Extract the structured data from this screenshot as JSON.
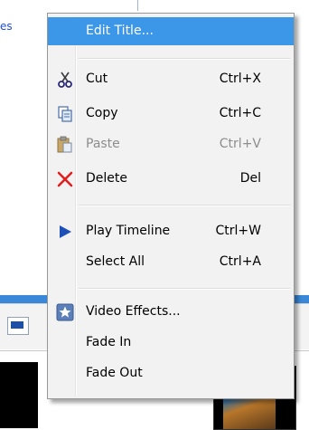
{
  "background": {
    "partial_text": "es"
  },
  "menu": {
    "items": [
      {
        "label": "Edit Title...",
        "shortcut": "",
        "icon": "",
        "state": "highlighted"
      },
      {
        "label": "Cut",
        "shortcut": "Ctrl+X",
        "icon": "scissors-icon",
        "state": "enabled"
      },
      {
        "label": "Copy",
        "shortcut": "Ctrl+C",
        "icon": "copy-icon",
        "state": "enabled"
      },
      {
        "label": "Paste",
        "shortcut": "Ctrl+V",
        "icon": "paste-icon",
        "state": "disabled"
      },
      {
        "label": "Delete",
        "shortcut": "Del",
        "icon": "delete-x-icon",
        "state": "enabled"
      },
      {
        "label": "Play Timeline",
        "shortcut": "Ctrl+W",
        "icon": "play-icon",
        "state": "enabled"
      },
      {
        "label": "Select All",
        "shortcut": "Ctrl+A",
        "icon": "",
        "state": "enabled"
      },
      {
        "label": "Video Effects...",
        "shortcut": "",
        "icon": "star-icon",
        "state": "enabled"
      },
      {
        "label": "Fade In",
        "shortcut": "",
        "icon": "",
        "state": "enabled"
      },
      {
        "label": "Fade Out",
        "shortcut": "",
        "icon": "",
        "state": "enabled"
      }
    ]
  },
  "colors": {
    "highlight": "#3d97e8",
    "delete_red": "#e02020",
    "play_blue": "#1e4fb8",
    "disabled_text": "#8d8d8d"
  }
}
